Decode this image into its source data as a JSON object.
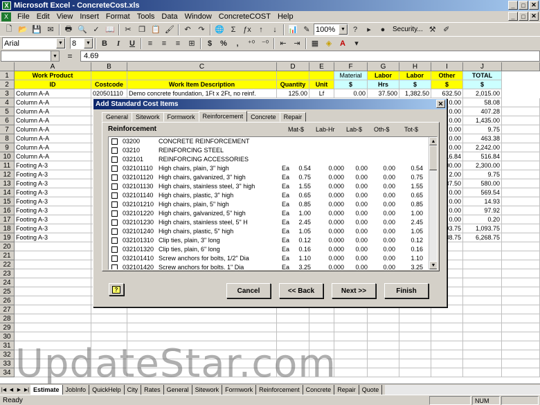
{
  "window": {
    "title": "Microsoft Excel - ConcreteCost.xls",
    "app_icon_letter": "X",
    "minimize": "_",
    "maximize": "□",
    "close": "✕"
  },
  "menu": [
    "File",
    "Edit",
    "View",
    "Insert",
    "Format",
    "Tools",
    "Data",
    "Window",
    "ConcreteCOST",
    "Help"
  ],
  "doc_controls": {
    "minimize": "_",
    "restore": "□",
    "close": "✕"
  },
  "toolbar": {
    "zoom": "100%",
    "security_label": "Security...",
    "sum_symbol": "Σ",
    "fx_symbol": "ƒx"
  },
  "format_bar": {
    "font": "Arial",
    "size": "8",
    "bold": "B",
    "italic": "I",
    "underline": "U",
    "currency": "$",
    "percent": "%",
    "comma": ","
  },
  "formula_bar": {
    "name_box": "",
    "equals": "=",
    "value": "4.69"
  },
  "columns": [
    "A",
    "B",
    "C",
    "D",
    "E",
    "F",
    "G",
    "H",
    "I",
    "J"
  ],
  "header_row1": {
    "A": "Work Product",
    "F": "Material",
    "G": "Labor",
    "H": "Labor",
    "I": "Other",
    "J": "TOTAL"
  },
  "header_row2": {
    "A": "ID",
    "B": "Costcode",
    "C": "Work Item Description",
    "D": "Quantity",
    "E": "Unit",
    "F": "$",
    "G": "Hrs",
    "H": "$",
    "I": "$",
    "J": "$"
  },
  "row3": {
    "A": "Column A-A",
    "B": "020501110",
    "C": "Demo concrete foundation, 1Ft x 2Ft, no reinf.",
    "D": "125.00",
    "E": "Lf",
    "F": "0.00",
    "G": "37.500",
    "H": "1,382.50",
    "I": "632.50",
    "J": "2,015.00"
  },
  "rows": [
    {
      "n": "4",
      "A": "Column A-A",
      "I": "0.00",
      "J": "58.08"
    },
    {
      "n": "5",
      "A": "Column A-A",
      "I": "0.00",
      "J": "407.28"
    },
    {
      "n": "6",
      "A": "Column A-A",
      "I": "0.00",
      "J": "1,435.00"
    },
    {
      "n": "7",
      "A": "Column A-A",
      "I": "0.00",
      "J": "9.75"
    },
    {
      "n": "8",
      "A": "Column A-A",
      "I": "0.00",
      "J": "463.38"
    },
    {
      "n": "9",
      "A": "Column A-A",
      "I": "0.00",
      "J": "2,242.00"
    },
    {
      "n": "10",
      "A": "Column A-A",
      "I": "16.84",
      "J": "516.84"
    },
    {
      "n": "11",
      "A": "Footing A-3",
      "I": "00.00",
      "J": "2,300.00"
    },
    {
      "n": "12",
      "A": "Footing A-3",
      "I": "2.00",
      "J": "9.75"
    },
    {
      "n": "13",
      "A": "Footing A-3",
      "I": "37.50",
      "J": "580.00"
    },
    {
      "n": "14",
      "A": "Footing A-3",
      "I": "0.00",
      "J": "569.54"
    },
    {
      "n": "15",
      "A": "Footing A-3",
      "I": "0.00",
      "J": "14.93"
    },
    {
      "n": "16",
      "A": "Footing A-3",
      "I": "0.00",
      "J": "97.92"
    },
    {
      "n": "17",
      "A": "Footing A-3",
      "I": "0.00",
      "J": "0.20"
    },
    {
      "n": "18",
      "A": "Footing A-3",
      "I": "93.75",
      "J": "1,093.75"
    },
    {
      "n": "19",
      "A": "Footing A-3",
      "I": "88.75",
      "J": "6,268.75"
    }
  ],
  "empty_rows": [
    "20",
    "21",
    "22",
    "23",
    "24",
    "25",
    "26",
    "27",
    "28",
    "29",
    "30",
    "31",
    "32",
    "33",
    "34"
  ],
  "dialog": {
    "title": "Add Standard Cost Items",
    "close": "✕",
    "tabs": [
      "General",
      "Sitework",
      "Formwork",
      "Reinforcement",
      "Concrete",
      "Repair"
    ],
    "active_tab": "Reinforcement",
    "panel_title": "Reinforcement",
    "col_headers": {
      "mat": "Mat-$",
      "labhr": "Lab-Hr",
      "lab": "Lab-$",
      "oth": "Oth-$",
      "tot": "Tot-$"
    },
    "items": [
      {
        "code": "03200",
        "desc": "CONCRETE REINFORCEMENT",
        "unit": "",
        "mat": "",
        "labhr": "",
        "lab": "",
        "oth": "",
        "tot": ""
      },
      {
        "code": "03210",
        "desc": "REINFORCING STEEL",
        "unit": "",
        "mat": "",
        "labhr": "",
        "lab": "",
        "oth": "",
        "tot": ""
      },
      {
        "code": "032101",
        "desc": "REINFORCING ACCESSORIES",
        "unit": "",
        "mat": "",
        "labhr": "",
        "lab": "",
        "oth": "",
        "tot": ""
      },
      {
        "code": "032101110",
        "desc": "High chairs, plain, 3\" high",
        "unit": "Ea",
        "mat": "0.54",
        "labhr": "0.000",
        "lab": "0.00",
        "oth": "0.00",
        "tot": "0.54"
      },
      {
        "code": "032101120",
        "desc": "High chairs, galvanized, 3\" high",
        "unit": "Ea",
        "mat": "0.75",
        "labhr": "0.000",
        "lab": "0.00",
        "oth": "0.00",
        "tot": "0.75"
      },
      {
        "code": "032101130",
        "desc": "High chairs, stainless steel, 3\" high",
        "unit": "Ea",
        "mat": "1.55",
        "labhr": "0.000",
        "lab": "0.00",
        "oth": "0.00",
        "tot": "1.55"
      },
      {
        "code": "032101140",
        "desc": "High chairs, plastic, 3\" high",
        "unit": "Ea",
        "mat": "0.65",
        "labhr": "0.000",
        "lab": "0.00",
        "oth": "0.00",
        "tot": "0.65"
      },
      {
        "code": "032101210",
        "desc": "High chairs, plain, 5\" high",
        "unit": "Ea",
        "mat": "0.85",
        "labhr": "0.000",
        "lab": "0.00",
        "oth": "0.00",
        "tot": "0.85"
      },
      {
        "code": "032101220",
        "desc": "High chairs, galvanized, 5\" high",
        "unit": "Ea",
        "mat": "1.00",
        "labhr": "0.000",
        "lab": "0.00",
        "oth": "0.00",
        "tot": "1.00"
      },
      {
        "code": "032101230",
        "desc": "High chairs, stainless steel, 5\" H",
        "unit": "Ea",
        "mat": "2.45",
        "labhr": "0.000",
        "lab": "0.00",
        "oth": "0.00",
        "tot": "2.45"
      },
      {
        "code": "032101240",
        "desc": "High chairs, plastic, 5\" high",
        "unit": "Ea",
        "mat": "1.05",
        "labhr": "0.000",
        "lab": "0.00",
        "oth": "0.00",
        "tot": "1.05"
      },
      {
        "code": "032101310",
        "desc": "Clip ties, plain, 3\" long",
        "unit": "Ea",
        "mat": "0.12",
        "labhr": "0.000",
        "lab": "0.00",
        "oth": "0.00",
        "tot": "0.12"
      },
      {
        "code": "032101320",
        "desc": "Clip ties, plain, 6\" long",
        "unit": "Ea",
        "mat": "0.16",
        "labhr": "0.000",
        "lab": "0.00",
        "oth": "0.00",
        "tot": "0.16"
      },
      {
        "code": "032101410",
        "desc": "Screw anchors for bolts, 1/2\" Dia",
        "unit": "Ea",
        "mat": "1.10",
        "labhr": "0.000",
        "lab": "0.00",
        "oth": "0.00",
        "tot": "1.10"
      },
      {
        "code": "032101420",
        "desc": "Screw anchors for bolts, 1\" Dia",
        "unit": "Ea",
        "mat": "3.25",
        "labhr": "0.000",
        "lab": "0.00",
        "oth": "0.00",
        "tot": "3.25"
      }
    ],
    "buttons": {
      "cancel": "Cancel",
      "back": "<< Back",
      "next": "Next >>",
      "finish": "Finish",
      "help": "?"
    }
  },
  "watermark": "UpdateStar.com",
  "sheet_tabs": [
    "Estimate",
    "JobInfo",
    "QuickHelp",
    "City",
    "Rates",
    "General",
    "Sitework",
    "Formwork",
    "Reinforcement",
    "Concrete",
    "Repair",
    "Quote"
  ],
  "active_sheet": "Estimate",
  "status": {
    "text": "Ready",
    "num": "NUM"
  }
}
